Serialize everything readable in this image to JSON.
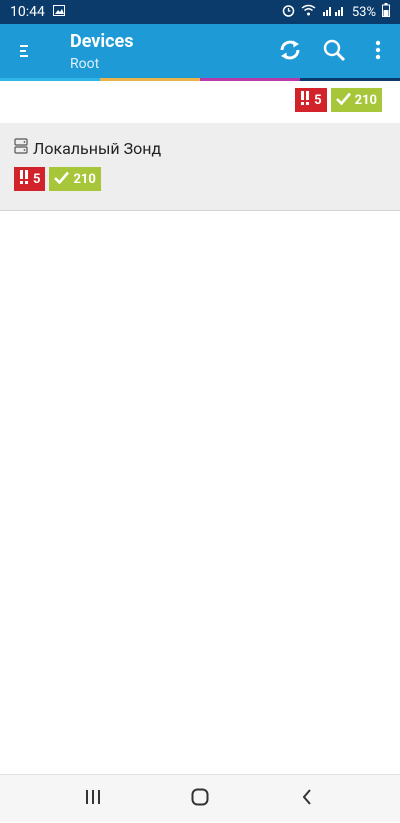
{
  "status_bar": {
    "time": "10:44",
    "battery": "53%",
    "icons": [
      "image-icon",
      "alarm-icon",
      "wifi-icon",
      "signal-icon",
      "battery-icon"
    ]
  },
  "app_bar": {
    "title": "Devices",
    "subtitle": "Root",
    "actions": [
      "refresh-icon",
      "search-icon",
      "more-vert-icon"
    ]
  },
  "color_strip": [
    "#2fb5e8",
    "#e8b34a",
    "#b83aa8",
    "#1e9ad6"
  ],
  "summary": {
    "alerts": "5",
    "ok": "210"
  },
  "devices": [
    {
      "name": "Локальный Зонд",
      "alerts": "5",
      "ok": "210"
    }
  ],
  "nav_bar": {
    "icons": [
      "recents-icon",
      "home-icon",
      "back-icon"
    ]
  },
  "colors": {
    "status_bar": "#0b3b6b",
    "app_bar": "#1e9ad6",
    "alert_red": "#d2232a",
    "ok_green": "#a8c63a"
  }
}
